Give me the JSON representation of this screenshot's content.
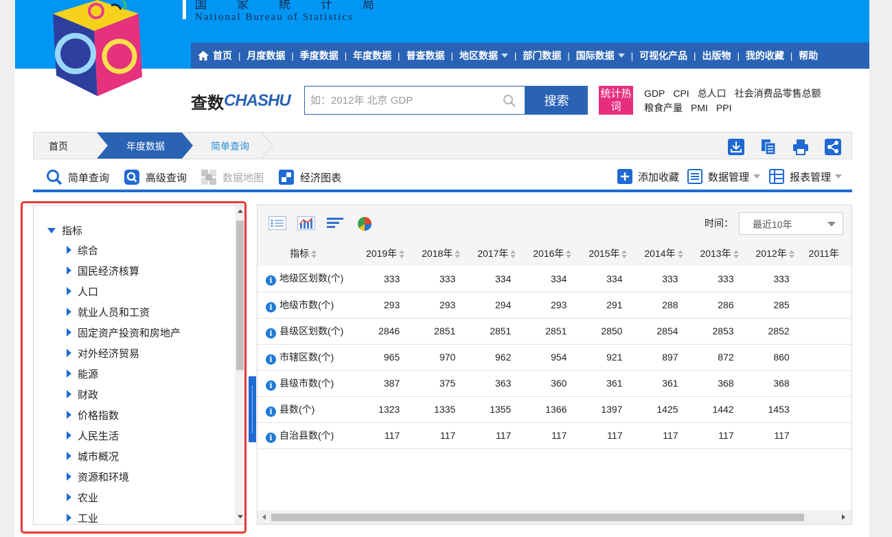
{
  "header": {
    "org_cn": "国家统计局",
    "org_en": "National Bureau of Statistics"
  },
  "nav": {
    "items": [
      {
        "label": "首页",
        "icon": "home-icon"
      },
      {
        "label": "月度数据"
      },
      {
        "label": "季度数据"
      },
      {
        "label": "年度数据"
      },
      {
        "label": "普查数据"
      },
      {
        "label": "地区数据",
        "dropdown": true
      },
      {
        "label": "部门数据"
      },
      {
        "label": "国际数据",
        "dropdown": true
      },
      {
        "label": "可视化产品"
      },
      {
        "label": "出版物"
      },
      {
        "label": "我的收藏"
      },
      {
        "label": "帮助"
      }
    ]
  },
  "search": {
    "logo_a": "查数",
    "logo_b": "CHASHU",
    "placeholder": "如：2012年 北京 GDP",
    "value": "",
    "button_label": "搜索",
    "hot_tag": "统计热词",
    "hot_words": [
      "GDP",
      "CPI",
      "总人口",
      "社会消费品零售总额",
      "粮食产量",
      "PMI",
      "PPI"
    ]
  },
  "breadcrumb": {
    "home": "首页",
    "level1": "年度数据",
    "current": "简单查询"
  },
  "toolbar": {
    "simple_query": "简单查询",
    "advanced_query": "高级查询",
    "data_map": "数据地图",
    "econ_chart": "经济图表",
    "add_favorite": "添加收藏",
    "data_manage": "数据管理",
    "report_manage": "报表管理"
  },
  "tree": {
    "root": "指标",
    "items": [
      "综合",
      "国民经济核算",
      "人口",
      "就业人员和工资",
      "固定资产投资和房地产",
      "对外经济贸易",
      "能源",
      "财政",
      "价格指数",
      "人民生活",
      "城市概况",
      "资源和环境",
      "农业",
      "工业"
    ]
  },
  "time_filter": {
    "label": "时间：",
    "value": "最近10年"
  },
  "table": {
    "indicator_header": "指标",
    "years": [
      "2019年",
      "2018年",
      "2017年",
      "2016年",
      "2015年",
      "2014年",
      "2013年",
      "2012年",
      "2011年"
    ],
    "rows": [
      {
        "name": "地级区划数(个)",
        "values": [
          "333",
          "333",
          "334",
          "334",
          "334",
          "333",
          "333",
          "333"
        ]
      },
      {
        "name": "地级市数(个)",
        "values": [
          "293",
          "293",
          "294",
          "293",
          "291",
          "288",
          "286",
          "285"
        ]
      },
      {
        "name": "县级区划数(个)",
        "values": [
          "2846",
          "2851",
          "2851",
          "2851",
          "2850",
          "2854",
          "2853",
          "2852"
        ]
      },
      {
        "name": "市辖区数(个)",
        "values": [
          "965",
          "970",
          "962",
          "954",
          "921",
          "897",
          "872",
          "860"
        ]
      },
      {
        "name": "县级市数(个)",
        "values": [
          "387",
          "375",
          "363",
          "360",
          "361",
          "361",
          "368",
          "368"
        ]
      },
      {
        "name": "县数(个)",
        "values": [
          "1323",
          "1335",
          "1355",
          "1366",
          "1397",
          "1425",
          "1442",
          "1453"
        ]
      },
      {
        "name": "自治县数(个)",
        "values": [
          "117",
          "117",
          "117",
          "117",
          "117",
          "117",
          "117",
          "117"
        ]
      }
    ]
  },
  "colors": {
    "header_blue": "#0096f4",
    "nav_blue": "#2a63b5",
    "accent_blue": "#1f6ad2",
    "hot_pink": "#e62e7d",
    "highlight_red": "#e53935"
  }
}
